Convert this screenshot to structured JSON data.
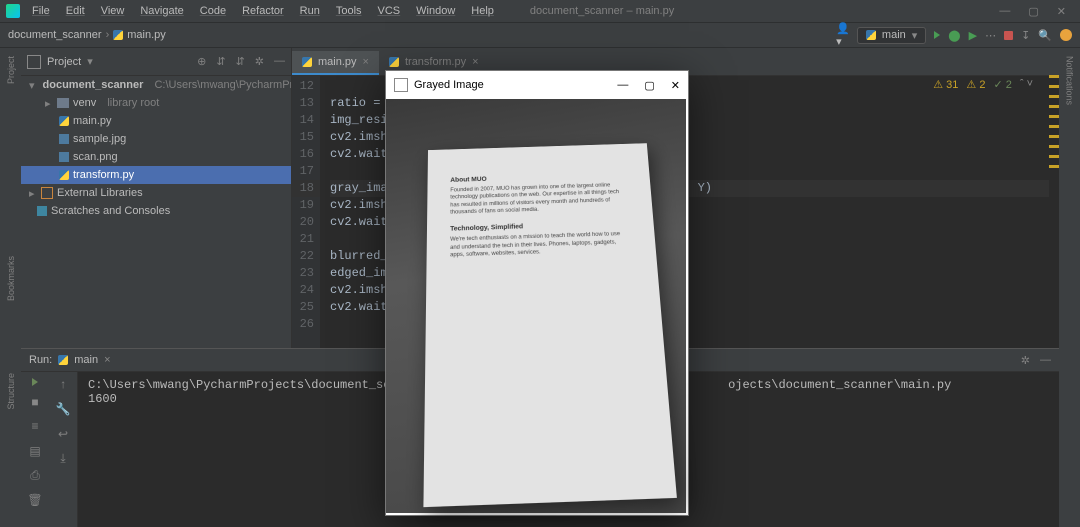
{
  "menus": {
    "file": "File",
    "edit": "Edit",
    "view": "View",
    "navigate": "Navigate",
    "code": "Code",
    "refactor": "Refactor",
    "run": "Run",
    "tools": "Tools",
    "vcs": "VCS",
    "window": "Window",
    "help": "Help"
  },
  "window_title": "document_scanner – main.py",
  "breadcrumb": {
    "project": "document_scanner",
    "file": "main.py"
  },
  "run_config": {
    "name": "main"
  },
  "project_tool": {
    "title": "Project",
    "root": "document_scanner",
    "root_path": "C:\\Users\\mwang\\PycharmProjects",
    "items": [
      "venv",
      "main.py",
      "sample.jpg",
      "scan.png",
      "transform.py"
    ],
    "venv_hint": "library root",
    "ext_lib": "External Libraries",
    "scratches": "Scratches and Consoles"
  },
  "editor_tabs": [
    {
      "label": "main.py",
      "active": true
    },
    {
      "label": "transform.py",
      "active": false
    }
  ],
  "gutter": [
    "12",
    "13",
    "14",
    "15",
    "16",
    "17",
    "18",
    "19",
    "20",
    "21",
    "22",
    "23",
    "24",
    "25",
    "26"
  ],
  "code_lines": [
    "",
    "ratio =",
    "img_resi",
    "cv2.imsh",
    "cv2.wait",
    "",
    "gray_ima",
    "cv2.imsh",
    "cv2.wait",
    "",
    "blurred_",
    "edged_im",
    "cv2.imsh",
    "cv2.wait",
    ""
  ],
  "code_tail": "Y)",
  "inspection": {
    "warn_yellow": "31",
    "warn_weak": "2",
    "ok": "2"
  },
  "run_panel": {
    "label": "Run:",
    "config": "main",
    "out_line1": "C:\\Users\\mwang\\PycharmProjects\\document_scanner\\ve",
    "out_line1b": "ojects\\document_scanner\\main.py",
    "out_line2": "1600"
  },
  "left_sidebar": {
    "project": "Project",
    "bookmarks": "Bookmarks",
    "structure": "Structure"
  },
  "right_sidebar": {
    "notifications": "Notifications"
  },
  "popup": {
    "title": "Grayed Image",
    "doc_h1": "About MUO",
    "doc_p1": "Founded in 2007, MUO has grown into one of the largest online technology publications on the web. Our expertise in all things tech has resulted in millions of visitors every month and hundreds of thousands of fans on social media.",
    "doc_h2": "Technology, Simplified",
    "doc_p2": "We're tech enthusiasts on a mission to teach the world how to use and understand the tech in their lives. Phones, laptops, gadgets, apps, software, websites, services."
  }
}
